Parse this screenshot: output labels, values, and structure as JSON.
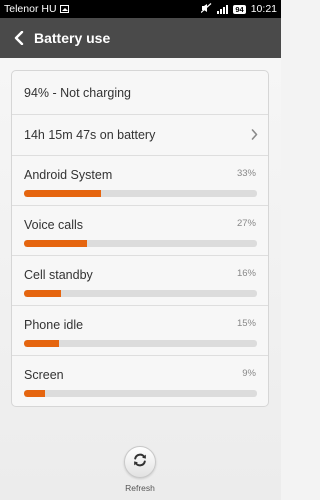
{
  "status_bar": {
    "carrier": "Telenor HU",
    "battery_level": "94",
    "time": "10:21"
  },
  "header": {
    "title": "Battery use",
    "back_icon": "chevron-left-icon"
  },
  "summary": {
    "status": "94% - Not charging",
    "time_on_battery": "14h 15m 47s on battery"
  },
  "apps": [
    {
      "name": "Android System",
      "percent_label": "33%",
      "fill_percent": 33
    },
    {
      "name": "Voice calls",
      "percent_label": "27%",
      "fill_percent": 27
    },
    {
      "name": "Cell standby",
      "percent_label": "16%",
      "fill_percent": 16
    },
    {
      "name": "Phone idle",
      "percent_label": "15%",
      "fill_percent": 15
    },
    {
      "name": "Screen",
      "percent_label": "9%",
      "fill_percent": 9
    }
  ],
  "footer": {
    "refresh_label": "Refresh"
  },
  "colors": {
    "accent": "#e5650f",
    "header_bg": "#4a4a4a",
    "track": "#dcdcdc"
  }
}
